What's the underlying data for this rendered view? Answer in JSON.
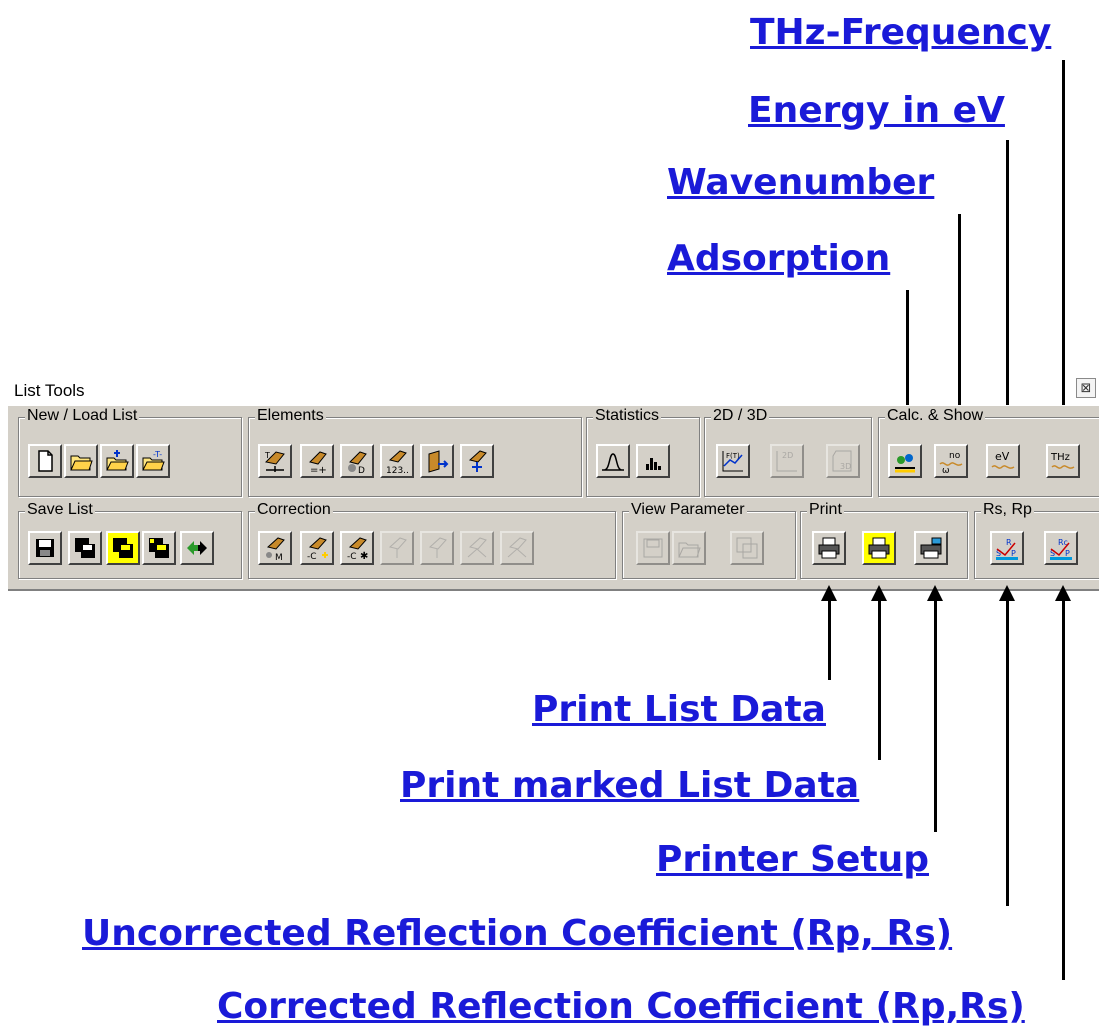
{
  "callouts": {
    "thz": "THz-Frequency",
    "energy": "Energy in eV",
    "wavenumber": "Wavenumber",
    "adsorption": "Adsorption",
    "print_list": "Print List Data",
    "print_marked": "Print marked List Data",
    "printer_setup": "Printer Setup",
    "uncorrected": "Uncorrected Reflection Coefficient (Rp, Rs)",
    "corrected": "Corrected Reflection Coefficient (Rp,Rs)"
  },
  "window": {
    "title": "List Tools",
    "close_glyph": "⊠"
  },
  "groups": {
    "new_load": "New / Load List",
    "elements": "Elements",
    "statistics": "Statistics",
    "view_2d3d": "2D / 3D",
    "calc_show": "Calc. & Show",
    "save_list": "Save List",
    "correction": "Correction",
    "view_parameter": "View Parameter",
    "print": "Print",
    "rs_rp": "Rs, Rp"
  },
  "icons": {
    "new_list": "new-document-icon",
    "open_list": "open-folder-icon",
    "add_list": "open-folder-plus-icon",
    "load_t": "open-folder-t-icon",
    "thz_text": "THz",
    "ev_text": "eV"
  },
  "colors": {
    "callout_blue": "#1a1ad8",
    "toolbar_gray": "#d4d0c8",
    "highlight_yellow": "#ffff00"
  }
}
